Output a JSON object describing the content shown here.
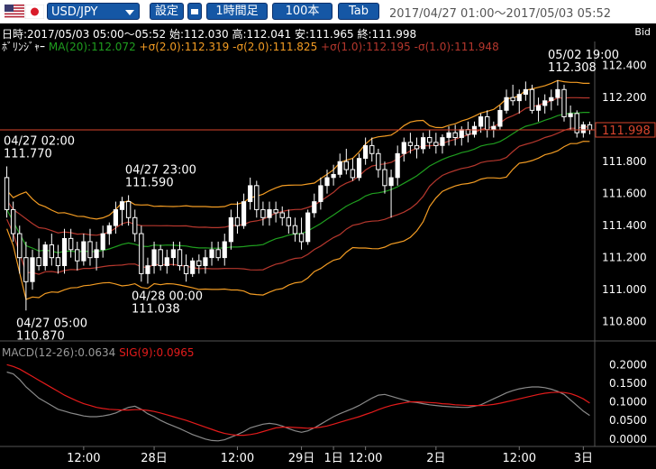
{
  "toolbar": {
    "symbol": "USD/JPY",
    "settings_label": "設定",
    "timeframe_label": "1時間足",
    "bars_label": "100本",
    "tab_label": "Tab",
    "range": "2017/04/27 01:00～2017/05/03 05:52"
  },
  "info_line": "日時:2017/05/03 05:00～05:52 始:112.030 高:112.041 安:111.965 終:111.998",
  "bid_label": "Bid",
  "legend": {
    "bb_name": "ﾎﾞﾘﾝｼﾞｬｰ",
    "ma": "MA(20):112.072",
    "up2": "+σ(2.0):112.319",
    "dn2": "-σ(2.0):111.825",
    "up1": "+σ(1.0):112.195",
    "dn1": "-σ(1.0):111.948"
  },
  "macd_legend": {
    "macd": "MACD(12-26):0.0634",
    "sig": "SIG(9):0.0965"
  },
  "colors": {
    "background": "#000000",
    "up_candle": "#ffffff",
    "down_candle": "#ffffff",
    "ma": "#1f9e1f",
    "sigma2": "#f39c23",
    "sigma1": "#b5372d",
    "price_line": "#d9452d",
    "price_tag": "#d9452d",
    "macd": "#8a8a8a",
    "signal": "#e31b1b",
    "toolbar_button": "#1557a5"
  },
  "chart_data": {
    "type": "candlestick",
    "title": "USD/JPY",
    "price_axis": {
      "ticks": [
        110.8,
        111.0,
        111.2,
        111.4,
        111.6,
        111.8,
        112.0,
        112.2,
        112.4
      ],
      "tick_labels": [
        "110.800",
        "111.000",
        "111.200",
        "111.400",
        "111.600",
        "111.800",
        "112.000",
        "112.200",
        "112.400"
      ],
      "range": [
        110.68,
        112.55
      ]
    },
    "current_price": "111.998",
    "x_axis_labels": [
      {
        "label": "12:00",
        "bar": 12
      },
      {
        "label": "28日",
        "bar": 23
      },
      {
        "label": "12:00",
        "bar": 36
      },
      {
        "label": "29日",
        "bar": 46
      },
      {
        "label": "1日",
        "bar": 51
      },
      {
        "label": "12:00",
        "bar": 56
      },
      {
        "label": "2日",
        "bar": 67
      },
      {
        "label": "12:00",
        "bar": 80
      },
      {
        "label": "3日",
        "bar": 90
      }
    ],
    "annotations": [
      {
        "date": "04/27 02:00",
        "price": "111.770",
        "bar": 1,
        "value": 111.77,
        "placement": "above"
      },
      {
        "date": "04/27 05:00",
        "price": "110.870",
        "bar": 4,
        "value": 110.87,
        "placement": "below"
      },
      {
        "date": "04/27 23:00",
        "price": "111.590",
        "bar": 21,
        "value": 111.59,
        "placement": "above"
      },
      {
        "date": "04/28 00:00",
        "price": "111.038",
        "bar": 22,
        "value": 111.038,
        "placement": "below"
      },
      {
        "date": "05/02 19:00",
        "price": "112.308",
        "bar": 87,
        "value": 112.308,
        "placement": "above"
      }
    ],
    "ohlc": [
      [
        111.7,
        111.77,
        111.45,
        111.5
      ],
      [
        111.5,
        111.55,
        111.3,
        111.35
      ],
      [
        111.35,
        111.4,
        111.1,
        111.2
      ],
      [
        111.2,
        111.3,
        110.87,
        111.05
      ],
      [
        111.05,
        111.25,
        111.0,
        111.2
      ],
      [
        111.2,
        111.32,
        111.12,
        111.15
      ],
      [
        111.15,
        111.3,
        111.12,
        111.28
      ],
      [
        111.28,
        111.35,
        111.15,
        111.2
      ],
      [
        111.2,
        111.28,
        111.1,
        111.15
      ],
      [
        111.15,
        111.38,
        111.1,
        111.32
      ],
      [
        111.32,
        111.38,
        111.2,
        111.25
      ],
      [
        111.25,
        111.3,
        111.12,
        111.18
      ],
      [
        111.18,
        111.35,
        111.15,
        111.3
      ],
      [
        111.3,
        111.38,
        111.15,
        111.2
      ],
      [
        111.2,
        111.3,
        111.12,
        111.25
      ],
      [
        111.25,
        111.4,
        111.2,
        111.35
      ],
      [
        111.35,
        111.42,
        111.28,
        111.4
      ],
      [
        111.4,
        111.55,
        111.35,
        111.5
      ],
      [
        111.5,
        111.58,
        111.4,
        111.55
      ],
      [
        111.55,
        111.59,
        111.4,
        111.45
      ],
      [
        111.45,
        111.5,
        111.3,
        111.35
      ],
      [
        111.35,
        111.4,
        111.05,
        111.1
      ],
      [
        111.1,
        111.2,
        111.038,
        111.15
      ],
      [
        111.15,
        111.3,
        111.1,
        111.25
      ],
      [
        111.25,
        111.28,
        111.12,
        111.15
      ],
      [
        111.15,
        111.25,
        111.1,
        111.2
      ],
      [
        111.2,
        111.3,
        111.15,
        111.25
      ],
      [
        111.25,
        111.3,
        111.12,
        111.15
      ],
      [
        111.15,
        111.22,
        111.05,
        111.1
      ],
      [
        111.1,
        111.2,
        111.08,
        111.18
      ],
      [
        111.18,
        111.22,
        111.1,
        111.15
      ],
      [
        111.15,
        111.25,
        111.1,
        111.2
      ],
      [
        111.2,
        111.3,
        111.15,
        111.25
      ],
      [
        111.25,
        111.3,
        111.18,
        111.2
      ],
      [
        111.2,
        111.35,
        111.15,
        111.3
      ],
      [
        111.3,
        111.5,
        111.25,
        111.45
      ],
      [
        111.45,
        111.55,
        111.35,
        111.4
      ],
      [
        111.4,
        111.6,
        111.38,
        111.55
      ],
      [
        111.55,
        111.7,
        111.5,
        111.65
      ],
      [
        111.65,
        111.68,
        111.45,
        111.5
      ],
      [
        111.5,
        111.55,
        111.4,
        111.45
      ],
      [
        111.45,
        111.55,
        111.4,
        111.5
      ],
      [
        111.5,
        111.55,
        111.42,
        111.48
      ],
      [
        111.48,
        111.52,
        111.4,
        111.45
      ],
      [
        111.45,
        111.5,
        111.35,
        111.4
      ],
      [
        111.4,
        111.45,
        111.3,
        111.35
      ],
      [
        111.35,
        111.45,
        111.25,
        111.3
      ],
      [
        111.3,
        111.5,
        111.28,
        111.48
      ],
      [
        111.48,
        111.6,
        111.45,
        111.55
      ],
      [
        111.55,
        111.7,
        111.5,
        111.65
      ],
      [
        111.65,
        111.75,
        111.6,
        111.7
      ],
      [
        111.7,
        111.78,
        111.65,
        111.72
      ],
      [
        111.72,
        111.85,
        111.7,
        111.8
      ],
      [
        111.8,
        111.88,
        111.72,
        111.75
      ],
      [
        111.75,
        111.82,
        111.68,
        111.7
      ],
      [
        111.7,
        111.85,
        111.68,
        111.82
      ],
      [
        111.82,
        111.95,
        111.78,
        111.9
      ],
      [
        111.9,
        111.95,
        111.8,
        111.85
      ],
      [
        111.85,
        111.88,
        111.7,
        111.75
      ],
      [
        111.75,
        111.8,
        111.6,
        111.65
      ],
      [
        111.65,
        111.75,
        111.45,
        111.7
      ],
      [
        111.7,
        111.9,
        111.65,
        111.85
      ],
      [
        111.85,
        111.95,
        111.8,
        111.92
      ],
      [
        111.92,
        111.98,
        111.85,
        111.9
      ],
      [
        111.9,
        111.95,
        111.82,
        111.88
      ],
      [
        111.88,
        111.98,
        111.85,
        111.95
      ],
      [
        111.95,
        112.0,
        111.88,
        111.92
      ],
      [
        111.92,
        111.98,
        111.85,
        111.9
      ],
      [
        111.9,
        111.97,
        111.85,
        111.95
      ],
      [
        111.95,
        112.02,
        111.9,
        111.98
      ],
      [
        111.98,
        112.03,
        111.9,
        111.95
      ],
      [
        111.95,
        112.02,
        111.9,
        112.0
      ],
      [
        112.0,
        112.05,
        111.92,
        111.97
      ],
      [
        111.97,
        112.05,
        111.95,
        112.02
      ],
      [
        112.02,
        112.1,
        111.98,
        112.08
      ],
      [
        112.08,
        112.12,
        111.95,
        112.0
      ],
      [
        112.0,
        112.05,
        111.95,
        112.02
      ],
      [
        112.02,
        112.15,
        112.0,
        112.12
      ],
      [
        112.12,
        112.25,
        112.1,
        112.2
      ],
      [
        112.2,
        112.28,
        112.15,
        112.18
      ],
      [
        112.18,
        112.25,
        112.1,
        112.22
      ],
      [
        112.22,
        112.3,
        112.18,
        112.25
      ],
      [
        112.25,
        112.28,
        112.1,
        112.12
      ],
      [
        112.12,
        112.2,
        112.05,
        112.15
      ],
      [
        112.15,
        112.22,
        112.1,
        112.18
      ],
      [
        112.18,
        112.25,
        112.12,
        112.2
      ],
      [
        112.2,
        112.308,
        112.15,
        112.25
      ],
      [
        112.25,
        112.28,
        112.05,
        112.08
      ],
      [
        112.08,
        112.15,
        112.0,
        112.1
      ],
      [
        112.1,
        112.12,
        111.95,
        111.98
      ],
      [
        111.98,
        112.05,
        111.95,
        112.03
      ],
      [
        112.03,
        112.05,
        111.97,
        111.998
      ]
    ],
    "macd_axis": {
      "ticks": [
        0.0,
        0.05,
        0.1,
        0.15,
        0.2
      ],
      "tick_labels": [
        "0.0000",
        "0.0500",
        "0.1000",
        "0.1500",
        "0.2000"
      ],
      "range": [
        -0.02,
        0.22
      ]
    },
    "macd": [
      0.18,
      0.175,
      0.16,
      0.14,
      0.125,
      0.11,
      0.1,
      0.09,
      0.08,
      0.075,
      0.07,
      0.066,
      0.062,
      0.06,
      0.06,
      0.062,
      0.065,
      0.07,
      0.078,
      0.085,
      0.088,
      0.08,
      0.068,
      0.06,
      0.05,
      0.042,
      0.035,
      0.028,
      0.02,
      0.012,
      0.006,
      0.0,
      -0.004,
      -0.005,
      -0.002,
      0.005,
      0.012,
      0.02,
      0.03,
      0.035,
      0.04,
      0.042,
      0.04,
      0.035,
      0.028,
      0.022,
      0.018,
      0.022,
      0.03,
      0.04,
      0.05,
      0.06,
      0.068,
      0.075,
      0.082,
      0.09,
      0.1,
      0.11,
      0.118,
      0.12,
      0.115,
      0.11,
      0.105,
      0.1,
      0.098,
      0.095,
      0.092,
      0.09,
      0.088,
      0.087,
      0.086,
      0.085,
      0.085,
      0.088,
      0.092,
      0.1,
      0.108,
      0.116,
      0.124,
      0.13,
      0.135,
      0.138,
      0.14,
      0.14,
      0.138,
      0.134,
      0.128,
      0.12,
      0.105,
      0.09,
      0.075,
      0.0634
    ],
    "signal": [
      0.2,
      0.195,
      0.188,
      0.178,
      0.168,
      0.158,
      0.148,
      0.138,
      0.128,
      0.118,
      0.11,
      0.102,
      0.095,
      0.09,
      0.085,
      0.082,
      0.08,
      0.079,
      0.078,
      0.078,
      0.079,
      0.079,
      0.077,
      0.074,
      0.07,
      0.065,
      0.06,
      0.055,
      0.05,
      0.044,
      0.038,
      0.032,
      0.026,
      0.02,
      0.015,
      0.012,
      0.01,
      0.01,
      0.012,
      0.015,
      0.02,
      0.025,
      0.03,
      0.032,
      0.032,
      0.031,
      0.03,
      0.029,
      0.03,
      0.032,
      0.035,
      0.04,
      0.045,
      0.05,
      0.055,
      0.06,
      0.066,
      0.072,
      0.079,
      0.085,
      0.09,
      0.094,
      0.097,
      0.1,
      0.1,
      0.099,
      0.098,
      0.097,
      0.095,
      0.094,
      0.092,
      0.091,
      0.09,
      0.09,
      0.09,
      0.091,
      0.093,
      0.096,
      0.1,
      0.104,
      0.108,
      0.112,
      0.116,
      0.12,
      0.123,
      0.125,
      0.126,
      0.125,
      0.122,
      0.116,
      0.108,
      0.0965
    ]
  }
}
